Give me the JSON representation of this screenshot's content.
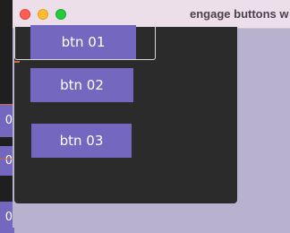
{
  "window": {
    "title": "engage buttons w"
  },
  "background": {
    "fragments": [
      "0",
      "0",
      "0"
    ]
  },
  "buttons": [
    {
      "label": "btn 01"
    },
    {
      "label": "btn 02"
    },
    {
      "label": "btn 03"
    }
  ],
  "colors": {
    "button": "#7367bf",
    "panel": "#2b2b2b",
    "titlebar": "#ecdfea",
    "desktop": "#b9b2cf",
    "accent_tick": "#c76a3a"
  }
}
